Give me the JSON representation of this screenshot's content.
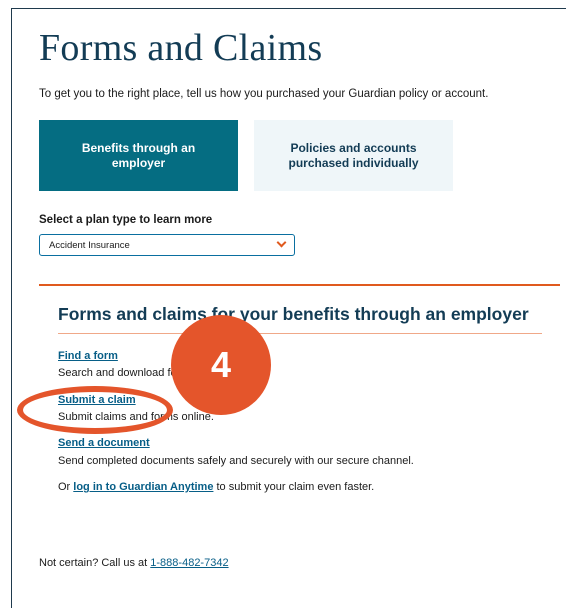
{
  "page": {
    "title": "Forms and Claims",
    "intro": "To get you to the right place, tell us how you purchased your Guardian policy or account."
  },
  "purchase_tiles": [
    {
      "label": "Benefits through an employer",
      "selected": true
    },
    {
      "label": "Policies and accounts purchased individually",
      "selected": false
    }
  ],
  "plan_select": {
    "label": "Select a plan type to learn more",
    "value": "Accident Insurance"
  },
  "section": {
    "title": "Forms and claims for your benefits through an employer",
    "items": [
      {
        "link": "Find a form",
        "description": "Search and download forms."
      },
      {
        "link": "Submit a claim",
        "description": "Submit claims and forms online."
      },
      {
        "link": "Send a document",
        "description": "Send completed documents safely and securely with our secure channel."
      }
    ],
    "login_prefix": "Or ",
    "login_link": "log in to Guardian Anytime",
    "login_suffix": " to submit your claim even faster."
  },
  "contact": {
    "prefix": "Not certain? Call us at ",
    "phone": "1-888-482-7342"
  },
  "annotation": {
    "step_number": "4",
    "color": "#e4552b"
  },
  "colors": {
    "brand_teal": "#056d82",
    "heading_navy": "#133c55",
    "link_blue": "#075e87",
    "accent_orange": "#e05a1e",
    "tile_light": "#eff6f9"
  }
}
